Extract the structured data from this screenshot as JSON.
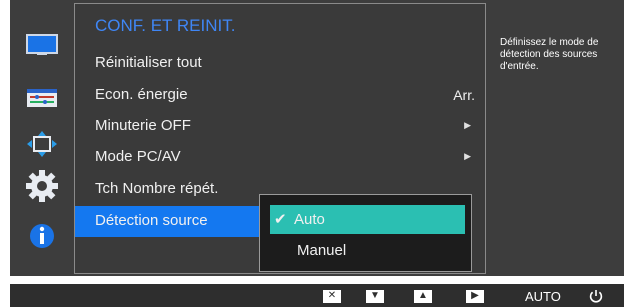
{
  "menu": {
    "title": "CONF. ET REINIT.",
    "items": [
      {
        "label": "Réinitialiser tout",
        "value": "",
        "has_submenu": false
      },
      {
        "label": "Econ. énergie",
        "value": "Arr.",
        "has_submenu": false
      },
      {
        "label": "Minuterie OFF",
        "value": "",
        "has_submenu": true
      },
      {
        "label": "Mode PC/AV",
        "value": "",
        "has_submenu": true
      },
      {
        "label": "Tch Nombre répét.",
        "value": "",
        "has_submenu": false
      },
      {
        "label": "Détection source",
        "value": "",
        "has_submenu": false
      }
    ],
    "selected_index": 5
  },
  "submenu": {
    "options": [
      {
        "label": "Auto",
        "selected": true
      },
      {
        "label": "Manuel",
        "selected": false
      }
    ]
  },
  "help": {
    "line1": "Définissez le mode de",
    "line2": "détection des sources",
    "line3": "d'entrée."
  },
  "bottom_bar": {
    "buttons": [
      {
        "icon": "close-icon",
        "glyph": "✕"
      },
      {
        "icon": "down-arrow-icon",
        "glyph": "▼"
      },
      {
        "icon": "up-arrow-icon",
        "glyph": "▲"
      },
      {
        "icon": "enter-icon",
        "glyph": "▶"
      }
    ],
    "auto_label": "AUTO",
    "power_icon": "power-icon"
  },
  "colors": {
    "accent_blue": "#1478f0",
    "title_blue": "#3f86f5",
    "active_teal": "#2bbfb2",
    "panel_bg": "#3d3d3d"
  },
  "sidebar_icons": [
    "picture-icon",
    "onscreen-display-icon",
    "position-icon",
    "settings-gear-icon",
    "information-icon"
  ]
}
